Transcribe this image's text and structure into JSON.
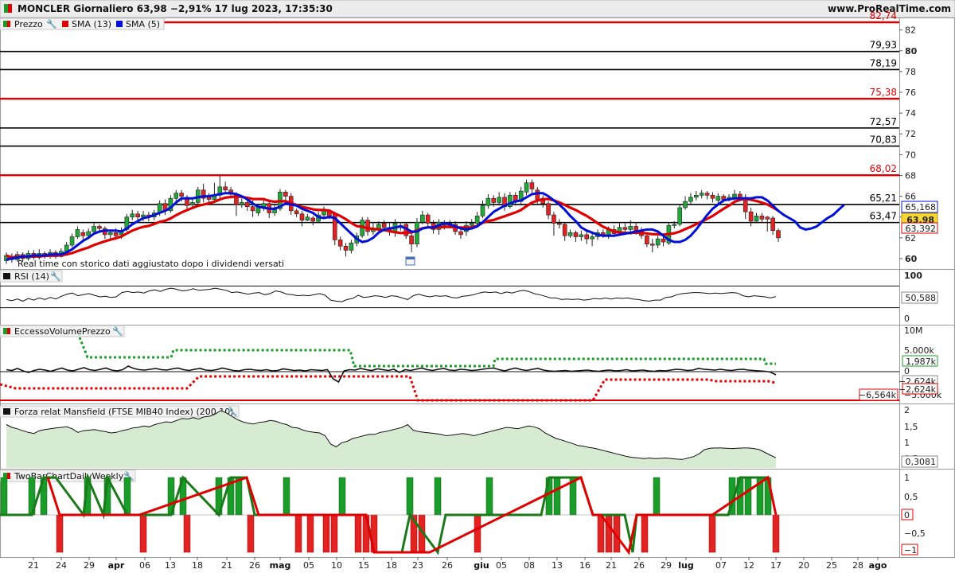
{
  "header": {
    "title": "MONCLER Giornaliero 63,98 −2,91% 17 lug 2023, 17:35:30",
    "site": "www.ProRealTime.com"
  },
  "price_panel": {
    "legend": [
      {
        "label": "Prezzo",
        "color": "#1a9c2a"
      },
      {
        "label": "SMA (13)",
        "color": "#e00000"
      },
      {
        "label": "SMA (5)",
        "color": "#0010d8"
      }
    ],
    "note": "Real time con storico dati aggiustato dopo i dividendi versati",
    "badges": {
      "sma5": "65,168",
      "last": "63,98",
      "sma13": "63,392"
    }
  },
  "panels": {
    "rsi": {
      "label": "RSI (14)",
      "value": "50,588",
      "ticks": [
        "100",
        "0"
      ]
    },
    "evp": {
      "label": "EccessoVolumePrezzo",
      "ticks": [
        "10M",
        "5.000k",
        "0",
        "−5.000k"
      ],
      "badges": [
        "1,987k",
        "−2,624k",
        "−2,624k",
        "−6,564k"
      ]
    },
    "mansfield": {
      "label": "Forza relat Mansfield (FTSE MIB40 Index) (200 10)",
      "value": "0,3081",
      "ticks": [
        "2",
        "1,5",
        "1",
        "0,5"
      ]
    },
    "twobar": {
      "label": "TwoBarChartDailyWeekly",
      "ticks": [
        "1",
        "0,5",
        "0",
        "−0,5",
        "−1"
      ]
    }
  },
  "chart_data": {
    "type": "candlestick",
    "x_axis": {
      "labels": [
        "21",
        "24",
        "29",
        "apr",
        "06",
        "13",
        "18",
        "21",
        "26",
        "mag",
        "05",
        "10",
        "15",
        "18",
        "23",
        "26",
        "giu",
        "05",
        "08",
        "13",
        "16",
        "21",
        "26",
        "29",
        "lug",
        "07",
        "12",
        "17",
        "20",
        "25",
        "28",
        "ago"
      ],
      "bold_labels": [
        "apr",
        "mag",
        "giu",
        "lug",
        "ago"
      ]
    },
    "y_axis": {
      "range": [
        59,
        83.2
      ],
      "ticks": [
        60,
        62,
        64,
        66,
        68,
        70,
        72,
        74,
        76,
        78,
        80,
        82
      ]
    },
    "levels": [
      {
        "value": 82.74,
        "label": "82,74",
        "color": "#e00000"
      },
      {
        "value": 79.93,
        "label": "79,93",
        "color": "#000000"
      },
      {
        "value": 78.19,
        "label": "78,19",
        "color": "#000000"
      },
      {
        "value": 75.38,
        "label": "75,38",
        "color": "#e00000"
      },
      {
        "value": 72.57,
        "label": "72,57",
        "color": "#000000"
      },
      {
        "value": 70.83,
        "label": "70,83",
        "color": "#000000"
      },
      {
        "value": 68.02,
        "label": "68,02",
        "color": "#e00000"
      },
      {
        "value": 65.21,
        "label": "65,21",
        "color": "#000000"
      },
      {
        "value": 63.47,
        "label": "63,47",
        "color": "#000000"
      }
    ],
    "candles": [
      [
        59.8,
        60.3,
        59.5,
        60.6
      ],
      [
        60.2,
        59.9,
        59.6,
        60.5
      ],
      [
        59.9,
        60.4,
        59.7,
        60.7
      ],
      [
        60.4,
        60.0,
        59.7,
        60.6
      ],
      [
        60.0,
        60.5,
        59.8,
        60.8
      ],
      [
        60.5,
        60.1,
        59.9,
        60.8
      ],
      [
        60.1,
        60.5,
        59.9,
        60.9
      ],
      [
        60.5,
        60.3,
        60.0,
        60.7
      ],
      [
        60.2,
        60.6,
        60.0,
        60.9
      ],
      [
        60.6,
        60.2,
        60.0,
        60.8
      ],
      [
        60.2,
        60.7,
        60.1,
        61.0
      ],
      [
        60.7,
        61.3,
        60.5,
        61.6
      ],
      [
        61.3,
        62.1,
        61.1,
        62.4
      ],
      [
        62.1,
        62.8,
        61.9,
        63.1
      ],
      [
        62.5,
        62.2,
        61.8,
        62.8
      ],
      [
        62.2,
        62.6,
        61.9,
        62.9
      ],
      [
        62.6,
        63.1,
        62.3,
        63.4
      ],
      [
        63.1,
        62.9,
        62.5,
        63.3
      ],
      [
        62.9,
        62.3,
        61.9,
        63.1
      ],
      [
        62.3,
        62.5,
        61.9,
        62.8
      ],
      [
        62.5,
        62.2,
        61.8,
        62.9
      ],
      [
        62.3,
        62.7,
        61.9,
        63.0
      ],
      [
        62.8,
        64.0,
        62.6,
        64.3
      ],
      [
        64.0,
        64.3,
        63.7,
        64.7
      ],
      [
        64.3,
        64.0,
        63.6,
        64.6
      ],
      [
        64.0,
        64.2,
        63.6,
        64.6
      ],
      [
        64.2,
        64.0,
        63.6,
        64.5
      ],
      [
        64.0,
        64.4,
        63.7,
        64.7
      ],
      [
        64.4,
        65.3,
        64.1,
        65.6
      ],
      [
        65.3,
        64.6,
        64.2,
        65.7
      ],
      [
        64.6,
        65.8,
        64.4,
        66.1
      ],
      [
        65.8,
        66.3,
        65.5,
        66.6
      ],
      [
        66.3,
        66.0,
        65.5,
        66.6
      ],
      [
        65.9,
        65.1,
        64.6,
        66.1
      ],
      [
        65.2,
        65.4,
        64.9,
        65.8
      ],
      [
        65.4,
        66.6,
        65.1,
        66.9
      ],
      [
        66.6,
        65.8,
        65.4,
        67.2
      ],
      [
        66.0,
        65.7,
        65.3,
        66.3
      ],
      [
        65.7,
        66.1,
        65.4,
        67.3
      ],
      [
        66.1,
        66.9,
        65.8,
        68.0
      ],
      [
        66.9,
        66.6,
        66.2,
        67.4
      ],
      [
        66.6,
        66.2,
        65.8,
        66.9
      ],
      [
        66.2,
        65.2,
        64.1,
        66.4
      ],
      [
        65.2,
        65.4,
        64.9,
        65.8
      ],
      [
        65.4,
        65.0,
        64.6,
        65.7
      ],
      [
        65.0,
        64.6,
        64.0,
        65.6
      ],
      [
        64.4,
        65.0,
        64.1,
        65.3
      ],
      [
        65.0,
        65.3,
        64.6,
        65.6
      ],
      [
        65.3,
        64.4,
        63.9,
        65.7
      ],
      [
        64.4,
        64.7,
        64.1,
        65.2
      ],
      [
        64.8,
        66.4,
        64.6,
        66.7
      ],
      [
        66.4,
        66.0,
        65.6,
        66.6
      ],
      [
        66.0,
        64.6,
        64.2,
        66.3
      ],
      [
        64.6,
        64.3,
        64.0,
        64.8
      ],
      [
        64.3,
        63.7,
        63.1,
        64.6
      ],
      [
        63.7,
        64.0,
        63.6,
        64.3
      ],
      [
        63.9,
        63.6,
        63.2,
        64.1
      ],
      [
        63.6,
        64.2,
        63.4,
        64.5
      ],
      [
        64.2,
        64.7,
        63.8,
        65.0
      ],
      [
        64.6,
        64.1,
        63.8,
        64.7
      ],
      [
        64.3,
        61.8,
        61.3,
        64.5
      ],
      [
        61.8,
        61.2,
        60.8,
        62.1
      ],
      [
        61.2,
        60.8,
        60.2,
        61.5
      ],
      [
        60.8,
        61.5,
        60.5,
        61.8
      ],
      [
        61.5,
        62.2,
        61.2,
        62.5
      ],
      [
        62.2,
        63.7,
        62.0,
        64.0
      ],
      [
        63.7,
        62.6,
        62.2,
        64.0
      ],
      [
        62.6,
        62.8,
        62.3,
        63.5
      ],
      [
        62.8,
        63.3,
        62.5,
        63.6
      ],
      [
        63.4,
        63.0,
        62.6,
        63.7
      ],
      [
        63.0,
        62.6,
        62.2,
        63.4
      ],
      [
        62.6,
        63.4,
        62.1,
        63.8
      ],
      [
        63.2,
        63.1,
        62.7,
        63.5
      ],
      [
        63.3,
        62.2,
        61.9,
        63.5
      ],
      [
        62.2,
        61.4,
        60.6,
        62.4
      ],
      [
        61.4,
        63.5,
        61.1,
        63.9
      ],
      [
        63.5,
        64.2,
        63.3,
        64.6
      ],
      [
        64.2,
        63.4,
        63.0,
        64.4
      ],
      [
        63.4,
        62.8,
        62.4,
        63.7
      ],
      [
        62.8,
        63.5,
        62.3,
        63.8
      ],
      [
        63.5,
        63.2,
        62.8,
        63.7
      ],
      [
        63.2,
        63.4,
        62.9,
        63.7
      ],
      [
        63.3,
        62.6,
        62.3,
        63.6
      ],
      [
        62.6,
        62.3,
        61.9,
        62.9
      ],
      [
        62.6,
        63.2,
        62.2,
        63.6
      ],
      [
        63.2,
        63.4,
        62.8,
        63.8
      ],
      [
        63.4,
        64.1,
        63.0,
        64.5
      ],
      [
        64.1,
        65.1,
        63.9,
        65.6
      ],
      [
        65.1,
        65.8,
        64.8,
        66.2
      ],
      [
        65.8,
        65.4,
        65.0,
        66.1
      ],
      [
        65.4,
        65.9,
        65.1,
        66.4
      ],
      [
        65.9,
        65.0,
        64.6,
        66.3
      ],
      [
        65.0,
        66.1,
        64.8,
        66.4
      ],
      [
        66.1,
        65.5,
        65.1,
        66.4
      ],
      [
        65.5,
        66.5,
        65.1,
        66.9
      ],
      [
        66.4,
        67.3,
        66.1,
        67.6
      ],
      [
        67.3,
        66.7,
        66.2,
        67.6
      ],
      [
        66.6,
        65.7,
        65.3,
        66.9
      ],
      [
        65.8,
        65.3,
        64.9,
        66.1
      ],
      [
        65.3,
        64.2,
        63.8,
        65.5
      ],
      [
        64.2,
        63.4,
        62.2,
        64.5
      ],
      [
        63.4,
        63.3,
        62.9,
        63.8
      ],
      [
        63.3,
        62.2,
        61.7,
        63.5
      ],
      [
        62.2,
        62.5,
        62.0,
        62.8
      ],
      [
        62.5,
        62.1,
        61.6,
        62.7
      ],
      [
        62.1,
        62.3,
        61.7,
        62.7
      ],
      [
        62.3,
        61.9,
        61.4,
        62.6
      ],
      [
        61.9,
        62.1,
        61.2,
        62.5
      ],
      [
        62.1,
        62.5,
        61.8,
        62.8
      ],
      [
        62.5,
        62.3,
        62.0,
        62.8
      ],
      [
        62.3,
        62.8,
        61.9,
        63.1
      ],
      [
        62.8,
        62.4,
        62.1,
        63.2
      ],
      [
        62.5,
        63.0,
        62.2,
        63.4
      ],
      [
        63.0,
        62.8,
        62.5,
        63.4
      ],
      [
        62.8,
        63.1,
        62.3,
        63.7
      ],
      [
        63.1,
        62.7,
        62.3,
        63.4
      ],
      [
        62.7,
        62.2,
        61.9,
        63.0
      ],
      [
        62.2,
        61.4,
        61.1,
        62.5
      ],
      [
        61.4,
        61.3,
        60.6,
        61.9
      ],
      [
        61.3,
        61.9,
        61.0,
        62.2
      ],
      [
        61.9,
        61.6,
        61.2,
        62.2
      ],
      [
        61.5,
        63.2,
        61.3,
        63.5
      ],
      [
        63.2,
        63.3,
        62.9,
        63.6
      ],
      [
        63.3,
        64.9,
        63.1,
        65.2
      ],
      [
        64.9,
        65.5,
        64.7,
        66.0
      ],
      [
        65.5,
        65.9,
        65.2,
        66.3
      ],
      [
        65.9,
        66.1,
        65.6,
        66.5
      ],
      [
        66.1,
        66.3,
        65.8,
        66.6
      ],
      [
        66.3,
        66.1,
        65.7,
        66.5
      ],
      [
        66.1,
        65.8,
        65.4,
        66.4
      ],
      [
        65.6,
        66.0,
        65.3,
        66.3
      ],
      [
        66.0,
        65.7,
        65.4,
        66.2
      ],
      [
        65.7,
        65.9,
        65.5,
        66.2
      ],
      [
        65.9,
        66.2,
        65.6,
        66.6
      ],
      [
        66.2,
        65.9,
        65.5,
        66.5
      ],
      [
        65.9,
        64.5,
        63.8,
        66.2
      ],
      [
        64.5,
        63.6,
        63.1,
        64.9
      ],
      [
        63.6,
        64.1,
        63.4,
        64.4
      ],
      [
        64.1,
        63.8,
        63.4,
        64.4
      ],
      [
        64.0,
        63.8,
        62.6,
        64.1
      ],
      [
        63.9,
        62.7,
        62.3,
        64.1
      ],
      [
        62.7,
        62.0,
        61.6,
        62.9
      ]
    ],
    "sma5": [
      59.9,
      60.0,
      60.1,
      60.2,
      60.2,
      60.3,
      60.3,
      60.3,
      60.4,
      60.4,
      60.4,
      60.6,
      60.9,
      61.3,
      61.7,
      62.0,
      62.4,
      62.6,
      62.7,
      62.7,
      62.7,
      62.6,
      62.9,
      63.3,
      63.6,
      63.9,
      64.0,
      64.2,
      64.4,
      64.6,
      64.9,
      65.4,
      65.8,
      65.8,
      65.8,
      65.9,
      66.0,
      66.0,
      66.1,
      66.2,
      66.3,
      66.3,
      66.2,
      66.0,
      65.7,
      65.3,
      65.0,
      64.9,
      64.8,
      64.8,
      65.0,
      65.3,
      65.2,
      65.1,
      64.8,
      64.6,
      64.4,
      64.0,
      63.9,
      64.0,
      63.9,
      63.4,
      62.9,
      62.4,
      61.9,
      61.6,
      61.7,
      62.0,
      62.5,
      62.8,
      62.9,
      63.0,
      63.1,
      62.9,
      62.6,
      62.6,
      62.9,
      63.0,
      63.0,
      63.2,
      63.4,
      63.3,
      63.1,
      62.9,
      62.8,
      62.9,
      63.1,
      63.5,
      64.0,
      64.5,
      64.8,
      65.1,
      65.3,
      65.5,
      65.6,
      65.9,
      66.2,
      66.3,
      66.3,
      66.0,
      65.6,
      65.2,
      64.7,
      64.1,
      63.6,
      63.0,
      62.7,
      62.5,
      62.3,
      62.2,
      62.2,
      62.2,
      62.3,
      62.4,
      62.5,
      62.6,
      62.7,
      62.8,
      62.8,
      62.6,
      62.2,
      61.8,
      61.6,
      61.6,
      61.8,
      62.2,
      62.8,
      63.5,
      64.2,
      64.8,
      65.2,
      65.6,
      65.7,
      65.8,
      65.8,
      65.8,
      65.8,
      65.9,
      65.9,
      65.6,
      65.1,
      64.6,
      64.2,
      63.9,
      63.6,
      63.0,
      62.8,
      62.9,
      63.1,
      63.5,
      63.9,
      64.2,
      64.7,
      65.17
    ]
  },
  "indicators": {
    "rsi": [
      45,
      43,
      46,
      42,
      47,
      44,
      48,
      45,
      49,
      46,
      51,
      55,
      57,
      52,
      54,
      56,
      53,
      50,
      51,
      49,
      50,
      58,
      60,
      58,
      59,
      57,
      61,
      63,
      60,
      64,
      66,
      64,
      61,
      62,
      65,
      62,
      63,
      64,
      66,
      64,
      62,
      58,
      59,
      57,
      55,
      57,
      58,
      54,
      56,
      61,
      59,
      55,
      54,
      52,
      53,
      52,
      54,
      56,
      53,
      44,
      42,
      41,
      45,
      47,
      53,
      49,
      50,
      52,
      51,
      49,
      52,
      51,
      48,
      45,
      52,
      55,
      52,
      50,
      52,
      51,
      52,
      49,
      48,
      51,
      52,
      54,
      57,
      59,
      58,
      59,
      56,
      59,
      57,
      60,
      62,
      60,
      56,
      54,
      51,
      48,
      48,
      45,
      46,
      45,
      46,
      44,
      45,
      47,
      46,
      48,
      46,
      48,
      47,
      48,
      46,
      45,
      43,
      42,
      44,
      44,
      49,
      50,
      54,
      56,
      57,
      58,
      58,
      57,
      56,
      57,
      56,
      57,
      58,
      57,
      52,
      50,
      52,
      51,
      50,
      48,
      50.588
    ],
    "evp_black": [
      0.5,
      0.3,
      0.8,
      0.2,
      -0.2,
      0.3,
      0.6,
      0.4,
      0.1,
      0.5,
      0.9,
      0.4,
      0.2,
      0.6,
      1.0,
      0.5,
      0.3,
      0.6,
      0.9,
      0.4,
      0.2,
      0.5,
      1.4,
      0.8,
      0.5,
      0.4,
      0.6,
      0.8,
      0.5,
      0.4,
      0.7,
      0.9,
      0.5,
      0.3,
      0.6,
      0.8,
      0.4,
      0.3,
      0.5,
      0.9,
      0.6,
      0.3,
      0.2,
      0.5,
      0.6,
      0.4,
      0.3,
      0.5,
      0.2,
      0.3,
      0.7,
      0.5,
      0.3,
      0.4,
      0.2,
      0.5,
      0.4,
      0.3,
      0.5,
      -1.8,
      -2.6,
      0.2,
      0.5,
      0.4,
      0.8,
      0.5,
      0.3,
      0.7,
      0.5,
      0.3,
      0.6,
      -0.2,
      0.5,
      0.3,
      0.6,
      0.9,
      0.5,
      0.3,
      0.6,
      0.8,
      0.4,
      0.3,
      0.6,
      0.5,
      0.3,
      0.4,
      0.6,
      0.8,
      0.9,
      0.5,
      0.2,
      0.6,
      0.9,
      0.5,
      0.3,
      0.6,
      0.8,
      0.4,
      0.2,
      0.1,
      0.2,
      0.3,
      0.1,
      0.2,
      0.3,
      0.4,
      0.2,
      0.1,
      0.3,
      0.4,
      0.2,
      0.3,
      0.5,
      0.2,
      0.3,
      0.4,
      0.2,
      0.1,
      0.3,
      0.2,
      0.4,
      0.6,
      0.5,
      0.3,
      0.4,
      0.8,
      0.6,
      0.5,
      0.4,
      0.6,
      0.4,
      0.3,
      0.5,
      0.6,
      0.4,
      0.3,
      0.2,
      0.1,
      -0.1,
      -0.8
    ],
    "mansfield": [
      1.5,
      1.4,
      1.35,
      1.28,
      1.22,
      1.18,
      1.28,
      1.32,
      1.35,
      1.38,
      1.4,
      1.42,
      1.35,
      1.22,
      1.28,
      1.3,
      1.32,
      1.28,
      1.25,
      1.2,
      1.22,
      1.28,
      1.32,
      1.38,
      1.4,
      1.45,
      1.42,
      1.5,
      1.55,
      1.6,
      1.58,
      1.65,
      1.72,
      1.7,
      1.75,
      1.7,
      1.78,
      1.8,
      1.88,
      2.0,
      1.92,
      1.8,
      1.68,
      1.6,
      1.55,
      1.52,
      1.58,
      1.6,
      1.65,
      1.62,
      1.55,
      1.5,
      1.4,
      1.38,
      1.3,
      1.25,
      1.22,
      1.2,
      1.1,
      0.8,
      0.7,
      0.85,
      0.9,
      1.0,
      1.05,
      1.1,
      1.15,
      1.15,
      1.22,
      1.25,
      1.3,
      1.35,
      1.4,
      1.5,
      1.3,
      1.25,
      1.22,
      1.2,
      1.18,
      1.15,
      1.1,
      1.12,
      1.15,
      1.18,
      1.15,
      1.1,
      1.15,
      1.2,
      1.25,
      1.3,
      1.35,
      1.4,
      1.38,
      1.35,
      1.4,
      1.45,
      1.42,
      1.35,
      1.2,
      1.1,
      1.0,
      0.95,
      0.88,
      0.82,
      0.75,
      0.72,
      0.68,
      0.65,
      0.6,
      0.55,
      0.5,
      0.45,
      0.4,
      0.35,
      0.32,
      0.3,
      0.28,
      0.3,
      0.28,
      0.29,
      0.3,
      0.28,
      0.26,
      0.25,
      0.3,
      0.35,
      0.45,
      0.6,
      0.65,
      0.66,
      0.66,
      0.65,
      0.64,
      0.65,
      0.66,
      0.66,
      0.64,
      0.6,
      0.5,
      0.4,
      0.3081
    ]
  }
}
